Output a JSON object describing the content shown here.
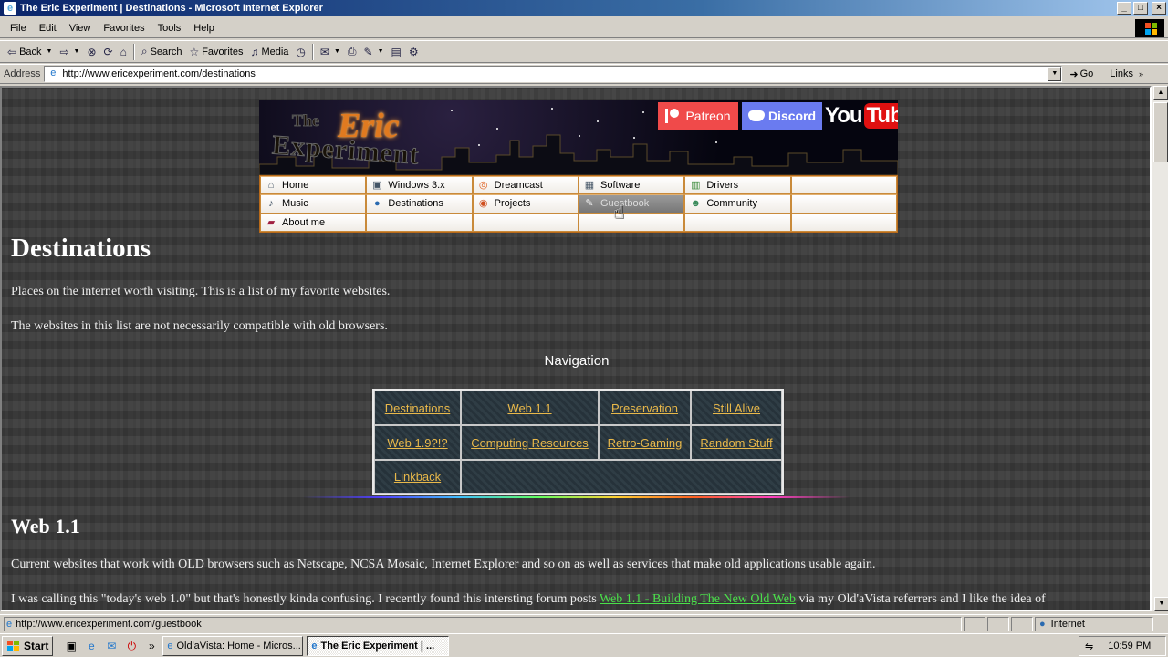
{
  "window": {
    "title": "The Eric Experiment | Destinations - Microsoft Internet Explorer",
    "min": "_",
    "max": "□",
    "close": "×"
  },
  "menu": [
    "File",
    "Edit",
    "View",
    "Favorites",
    "Tools",
    "Help"
  ],
  "toolbar": {
    "back": "Back",
    "search": "Search",
    "favorites": "Favorites",
    "media": "Media"
  },
  "address": {
    "label": "Address",
    "url": "http://www.ericexperiment.com/destinations",
    "go": "Go",
    "links": "Links"
  },
  "banner": {
    "logo_the": "The",
    "logo_eric": "Eric",
    "logo_experiment": "Experiment",
    "patreon": "Patreon",
    "discord": "Discord",
    "youtube_you": "You",
    "youtube_tube": "Tube"
  },
  "site_nav": [
    {
      "label": "Home",
      "icon": "home-icon"
    },
    {
      "label": "Windows 3.x",
      "icon": "windows-icon"
    },
    {
      "label": "Dreamcast",
      "icon": "dreamcast-icon"
    },
    {
      "label": "Software",
      "icon": "software-icon"
    },
    {
      "label": "Drivers",
      "icon": "drivers-icon"
    },
    {
      "label": "",
      "icon": ""
    },
    {
      "label": "Music",
      "icon": "music-icon"
    },
    {
      "label": "Destinations",
      "icon": "globe-icon"
    },
    {
      "label": "Projects",
      "icon": "projects-icon"
    },
    {
      "label": "Guestbook",
      "icon": "guestbook-icon"
    },
    {
      "label": "Community",
      "icon": "community-icon"
    },
    {
      "label": "",
      "icon": ""
    },
    {
      "label": "About me",
      "icon": "book-icon"
    },
    {
      "label": "",
      "icon": ""
    },
    {
      "label": "",
      "icon": ""
    },
    {
      "label": "",
      "icon": ""
    },
    {
      "label": "",
      "icon": ""
    },
    {
      "label": "",
      "icon": ""
    }
  ],
  "page": {
    "title": "Destinations",
    "intro": "Places on the internet worth visiting. This is a list of my favorite websites.",
    "disclaimer": "The websites in this list are not necessarily compatible with old browsers.",
    "nav_heading": "Navigation",
    "nav_links": [
      "Destinations",
      "Web 1.1",
      "Preservation",
      "Still Alive",
      "Web 1.9?!?",
      "Computing Resources",
      "Retro-Gaming",
      "Random Stuff",
      "Linkback"
    ],
    "section_title": "Web 1.1",
    "section_p1": "Current websites that work with OLD browsers such as Netscape, NCSA Mosaic, Internet Explorer and so on as well as services that make old applications usable again.",
    "section_p2_before": "I was calling this \"today's web 1.0\" but that's honestly kinda confusing. I recently found this intersting forum posts",
    "section_p2_link": "Web 1.1 - Building The New Old Web",
    "section_p2_after": "via my Old'aVista referrers and I like the idea of"
  },
  "status": {
    "url": "http://www.ericexperiment.com/guestbook",
    "zone": "Internet"
  },
  "taskbar": {
    "start": "Start",
    "tasks": [
      "Old'aVista: Home - Micros...",
      "The Eric Experiment | ..."
    ],
    "time": "10:59 PM"
  }
}
